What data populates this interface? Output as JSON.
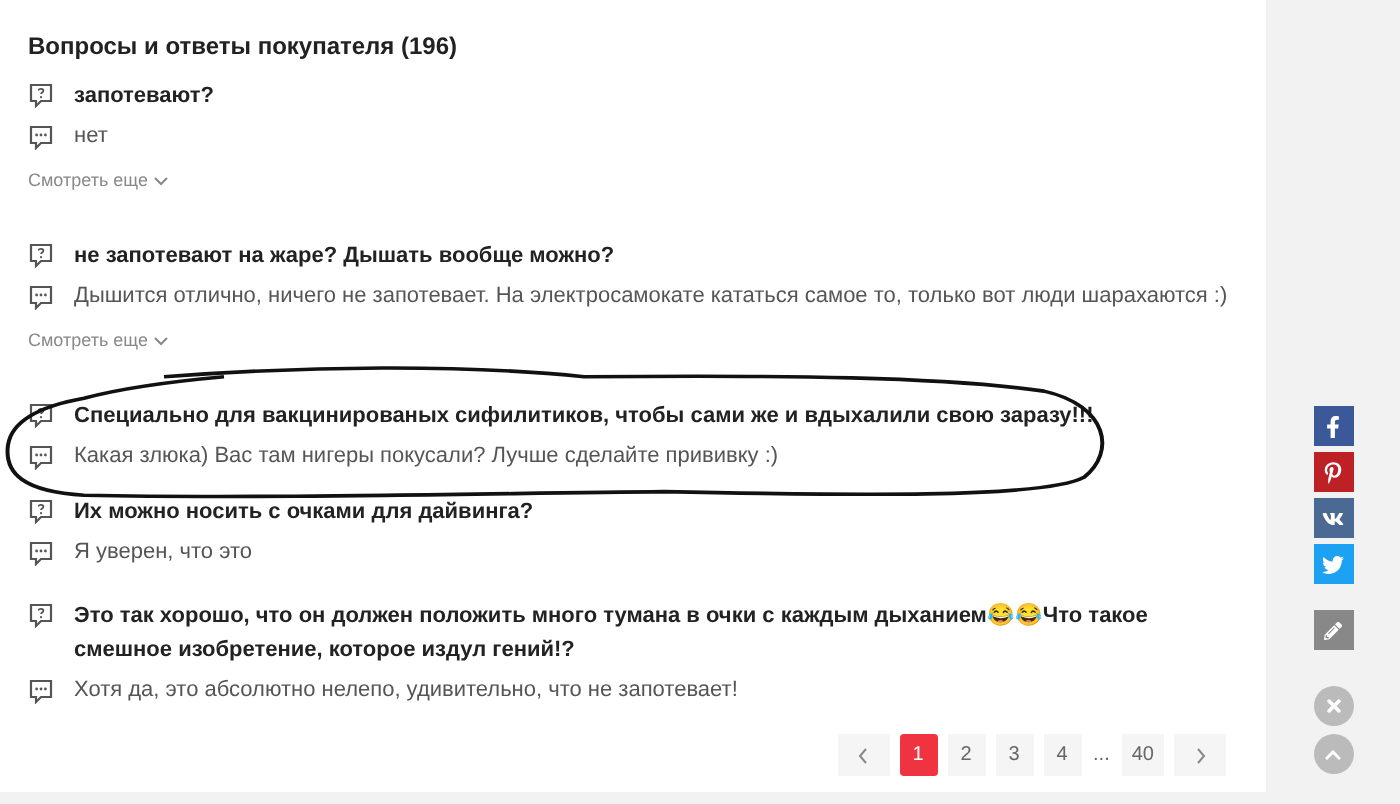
{
  "title": "Вопросы и ответы покупателя (196)",
  "questions": [
    {
      "question": "запотевают?",
      "answer": "нет",
      "more": "Смотреть еще",
      "circled": false
    },
    {
      "question": "не запотевают на жаре? Дышать вообще можно?",
      "answer": "Дышится отлично, ничего не запотевает. На электросамокате кататься самое то, только вот люди шарахаются :)",
      "more": "Смотреть еще",
      "circled": false
    },
    {
      "question": "Специально для вакцинированых сифилитиков, чтобы сами же и вдыхалили свою заразу!!!",
      "answer": "Какая злюка) Вас там нигеры покусали? Лучше сделайте прививку :)",
      "circled": true
    },
    {
      "question": "Их можно носить с очками для дайвинга?",
      "answer": "Я уверен, что это",
      "circled": false
    },
    {
      "question": "Это так хорошо, что он должен положить много тумана в очки с каждым дыханием😂😂Что такое смешное изобретение, которое издул гений!?",
      "answer": "Хотя да, это абсолютно нелепо, удивительно, что не запотевает!",
      "circled": false
    }
  ],
  "pagination": [
    {
      "label": "1",
      "selected": true
    },
    {
      "label": "2",
      "selected": false
    },
    {
      "label": "3",
      "selected": false
    },
    {
      "label": "4",
      "selected": false
    },
    {
      "label": "...",
      "kind": "ellipsis"
    },
    {
      "label": "40",
      "selected": false
    }
  ]
}
